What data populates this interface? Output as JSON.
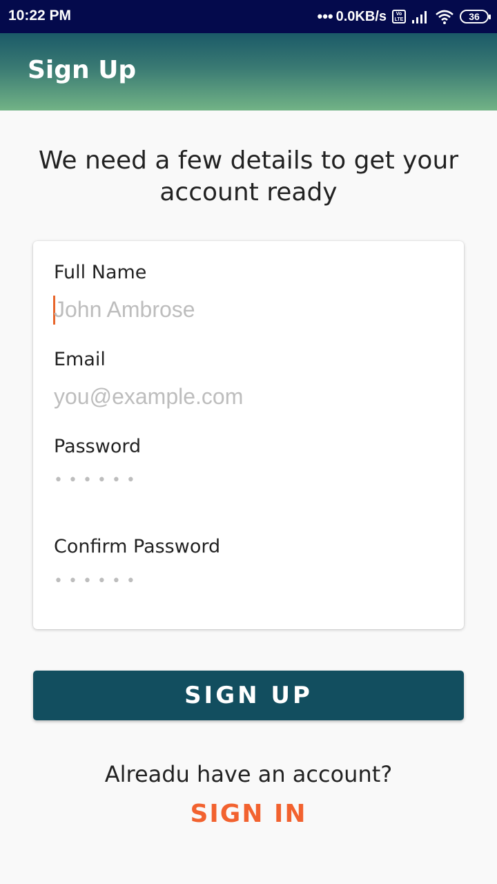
{
  "status_bar": {
    "time": "10:22 PM",
    "dots": "•••",
    "network_speed": "0.0KB/s",
    "volte_text": "Vo LTE",
    "battery": "36",
    "icons": [
      "volte-icon",
      "signal-icon",
      "wifi-icon",
      "battery-icon"
    ]
  },
  "app_bar": {
    "title": "Sign Up",
    "gradient_colors": [
      "#1b5a68",
      "#72b386"
    ]
  },
  "intro_text": "We need a few details to get your account ready",
  "form": {
    "full_name": {
      "label": "Full Name",
      "placeholder": "John Ambrose"
    },
    "email": {
      "label": "Email",
      "placeholder": "you@example.com"
    },
    "password": {
      "label": "Password",
      "placeholder": "••••••"
    },
    "confirm_password": {
      "label": "Confirm Password",
      "placeholder": "••••••"
    }
  },
  "signup_button": {
    "label": "SIGN UP",
    "color": "#124e5f"
  },
  "footer": {
    "prompt": "Alreadu have an account?",
    "signin_label": "SIGN IN",
    "signin_color": "#f2622f"
  },
  "colors": {
    "status_bar": "#040a4c",
    "background": "#f9f9f9",
    "caret": "#e8652b"
  }
}
